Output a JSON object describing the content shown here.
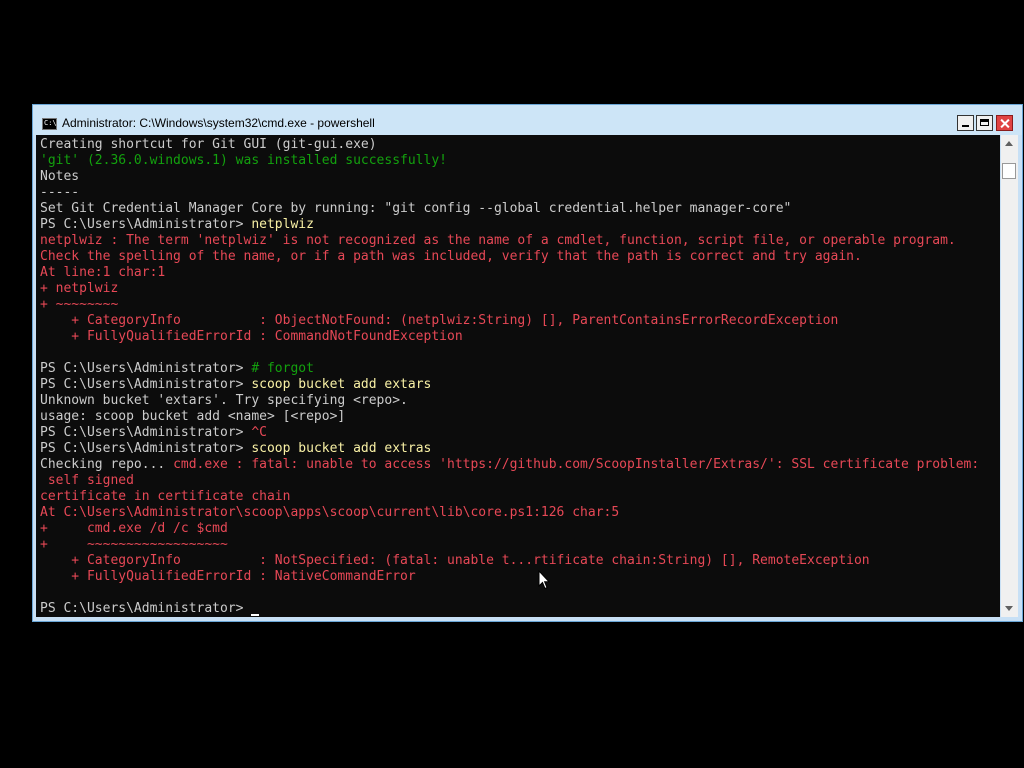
{
  "window": {
    "title": "Administrator: C:\\Windows\\system32\\cmd.exe - powershell",
    "icon_label": "C:\\"
  },
  "console": {
    "lines": [
      [
        {
          "t": "Creating shortcut for Git GUI (git-gui.exe)",
          "c": "w"
        }
      ],
      [
        {
          "t": "'git' (2.36.0.windows.1) was installed successfully!",
          "c": "g"
        }
      ],
      [
        {
          "t": "Notes",
          "c": "w"
        }
      ],
      [
        {
          "t": "-----",
          "c": "w"
        }
      ],
      [
        {
          "t": "Set Git Credential Manager Core by running: \"git config --global credential.helper manager-core\"",
          "c": "w"
        }
      ],
      [
        {
          "t": "PS C:\\Users\\Administrator> ",
          "c": "w"
        },
        {
          "t": "netplwiz",
          "c": "y"
        }
      ],
      [
        {
          "t": "netplwiz : The term 'netplwiz' is not recognized as the name of a cmdlet, function, script file, or operable program.",
          "c": "r"
        }
      ],
      [
        {
          "t": "Check the spelling of the name, or if a path was included, verify that the path is correct and try again.",
          "c": "r"
        }
      ],
      [
        {
          "t": "At line:1 char:1",
          "c": "r"
        }
      ],
      [
        {
          "t": "+ netplwiz",
          "c": "r"
        }
      ],
      [
        {
          "t": "+ ~~~~~~~~",
          "c": "r"
        }
      ],
      [
        {
          "t": "    + CategoryInfo          : ObjectNotFound: (netplwiz:String) [], ParentContainsErrorRecordException",
          "c": "r"
        }
      ],
      [
        {
          "t": "    + FullyQualifiedErrorId : CommandNotFoundException",
          "c": "r"
        }
      ],
      [
        {
          "t": "",
          "c": "w"
        }
      ],
      [
        {
          "t": "PS C:\\Users\\Administrator> ",
          "c": "w"
        },
        {
          "t": "# forgot",
          "c": "dg"
        }
      ],
      [
        {
          "t": "PS C:\\Users\\Administrator> ",
          "c": "w"
        },
        {
          "t": "scoop bucket add extars",
          "c": "y"
        }
      ],
      [
        {
          "t": "Unknown bucket 'extars'. Try specifying <repo>.",
          "c": "w"
        }
      ],
      [
        {
          "t": "usage: scoop bucket add <name> [<repo>]",
          "c": "w"
        }
      ],
      [
        {
          "t": "PS C:\\Users\\Administrator> ",
          "c": "w"
        },
        {
          "t": "^C",
          "c": "r"
        }
      ],
      [
        {
          "t": "PS C:\\Users\\Administrator> ",
          "c": "w"
        },
        {
          "t": "scoop bucket add extras",
          "c": "y"
        }
      ],
      [
        {
          "t": "Checking repo... ",
          "c": "w"
        },
        {
          "t": "cmd.exe : fatal: unable to access 'https://github.com/ScoopInstaller/Extras/': SSL certificate problem:",
          "c": "r"
        }
      ],
      [
        {
          "t": " self signed",
          "c": "r"
        }
      ],
      [
        {
          "t": "certificate in certificate chain",
          "c": "r"
        }
      ],
      [
        {
          "t": "At C:\\Users\\Administrator\\scoop\\apps\\scoop\\current\\lib\\core.ps1:126 char:5",
          "c": "r"
        }
      ],
      [
        {
          "t": "+     cmd.exe /d /c $cmd",
          "c": "r"
        }
      ],
      [
        {
          "t": "+     ~~~~~~~~~~~~~~~~~~",
          "c": "r"
        }
      ],
      [
        {
          "t": "    + CategoryInfo          : NotSpecified: (fatal: unable t...rtificate chain:String) [], RemoteException",
          "c": "r"
        }
      ],
      [
        {
          "t": "    + FullyQualifiedErrorId : NativeCommandError",
          "c": "r"
        }
      ],
      [
        {
          "t": "",
          "c": "w"
        }
      ],
      [
        {
          "t": "PS C:\\Users\\Administrator> ",
          "c": "w"
        }
      ]
    ]
  },
  "colors": {
    "console_bg": "#0c0c0c",
    "text": "#cccccc",
    "success": "#13a10e",
    "error": "#e74856",
    "command": "#f9f1a5"
  }
}
